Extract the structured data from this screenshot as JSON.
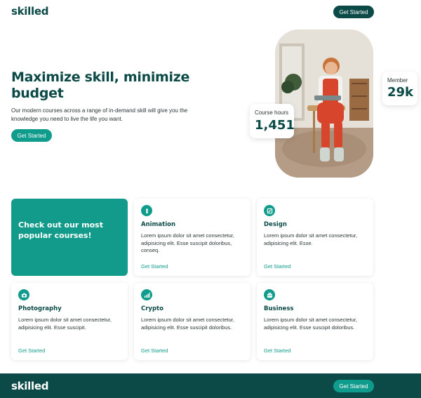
{
  "header": {
    "logo": "skilled",
    "cta_label": "Get Started"
  },
  "hero": {
    "title": "Maximize skill, minimize budget",
    "description": "Our modern courses across a range of in-demand skill will give you the knowledge you need to live the life you want.",
    "cta_label": "Get Started",
    "photo_icon": "student-photo",
    "stats": {
      "hours": {
        "label": "Course hours",
        "value": "1,451"
      },
      "members": {
        "label": "Member",
        "value": "29k"
      }
    }
  },
  "courses": {
    "feature_title": "Check out our most popular courses!",
    "items": [
      {
        "icon": "animation-icon",
        "title": "Animation",
        "description": "Lorem ipsum dolor sit amet consectetur, adipisicing elit. Esse suscipit doloribus, conseq.",
        "link": "Get Started"
      },
      {
        "icon": "design-icon",
        "title": "Design",
        "description": "Lorem ipsum dolor sit amet consectetur, adipisicing elit. Esse.",
        "link": "Get Started"
      },
      {
        "icon": "camera-icon",
        "title": "Photography",
        "description": "Lorem ipsum dolor sit amet consectetur, adipisicing elit. Esse suscipit.",
        "link": "Get Started"
      },
      {
        "icon": "chart-icon",
        "title": "Crypto",
        "description": "Lorem ipsum dolor sit amet consectetur, adipisicing elit. Esse suscipit doloribus.",
        "link": "Get Started"
      },
      {
        "icon": "briefcase-icon",
        "title": "Business",
        "description": "Lorem ipsum dolor sit amet consectetur, adipisicing elit. Esse suscipit doloribus.",
        "link": "Get Started"
      }
    ]
  },
  "footer": {
    "logo": "skilled",
    "cta_label": "Get Started"
  },
  "colors": {
    "brand": "#0b4a47",
    "accent": "#109c8c",
    "card": "#129b8a"
  }
}
